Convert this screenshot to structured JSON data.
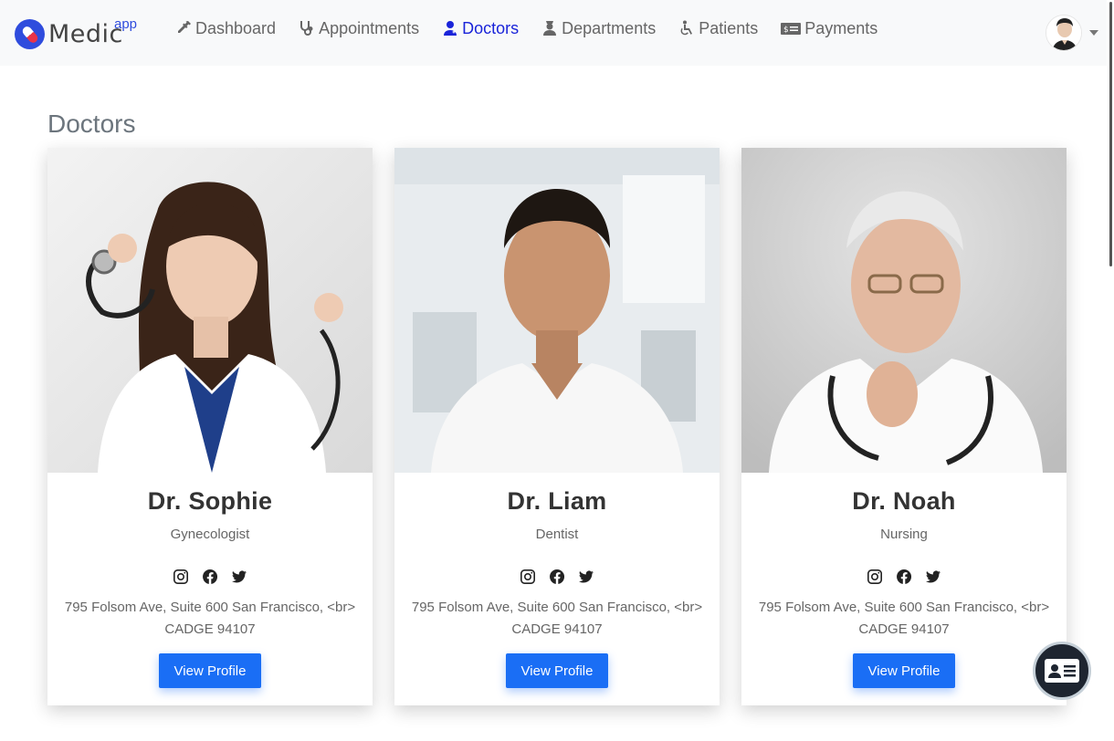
{
  "brand": {
    "name": "Medic",
    "sup": "app",
    "logo_color": "#2f4cdd"
  },
  "nav": {
    "items": [
      {
        "label": "Dashboard",
        "icon": "syringe-icon"
      },
      {
        "label": "Appointments",
        "icon": "stethoscope-icon"
      },
      {
        "label": "Doctors",
        "icon": "user-doctor-icon",
        "active": true
      },
      {
        "label": "Departments",
        "icon": "user-nurse-icon"
      },
      {
        "label": "Patients",
        "icon": "wheelchair-icon"
      },
      {
        "label": "Payments",
        "icon": "money-bill-icon"
      }
    ],
    "active_color": "#1a24d9"
  },
  "page": {
    "title": "Doctors"
  },
  "doctors": [
    {
      "name": "Dr. Sophie",
      "specialty": "Gynecologist",
      "address": "795 Folsom Ave, Suite 600 San Francisco, <br> CADGE 94107",
      "button": "View Profile"
    },
    {
      "name": "Dr. Liam",
      "specialty": "Dentist",
      "address": "795 Folsom Ave, Suite 600 San Francisco, <br> CADGE 94107",
      "button": "View Profile"
    },
    {
      "name": "Dr. Noah",
      "specialty": "Nursing",
      "address": "795 Folsom Ave, Suite 600 San Francisco, <br> CADGE 94107",
      "button": "View Profile"
    }
  ],
  "colors": {
    "button": "#1a6ef5",
    "fab": "#1e2530"
  }
}
